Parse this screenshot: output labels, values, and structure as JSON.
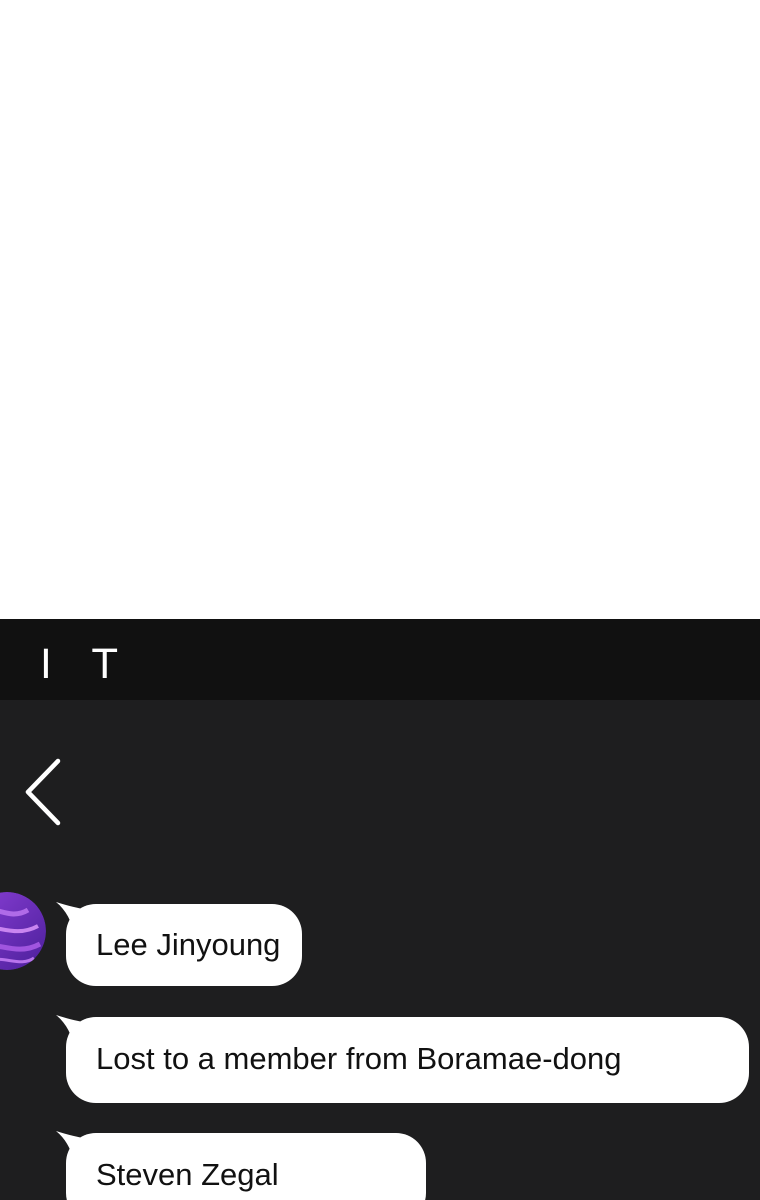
{
  "status_bar": {
    "text": "I T"
  },
  "header": {
    "back_icon": "chevron-left-icon"
  },
  "chat": {
    "sender": {
      "avatar_icon": "purple-swirl-avatar"
    },
    "messages": [
      {
        "text": "Lee Jinyoung"
      },
      {
        "text": "Lost to a member from Boramae-dong"
      },
      {
        "text": "Steven Zegal"
      }
    ]
  },
  "colors": {
    "page_background": "#ffffff",
    "app_background": "#1e1e1f",
    "status_bar_background": "#111111",
    "bubble_background": "#ffffff",
    "bubble_text": "#111111",
    "avatar_primary": "#6a2fb8"
  }
}
